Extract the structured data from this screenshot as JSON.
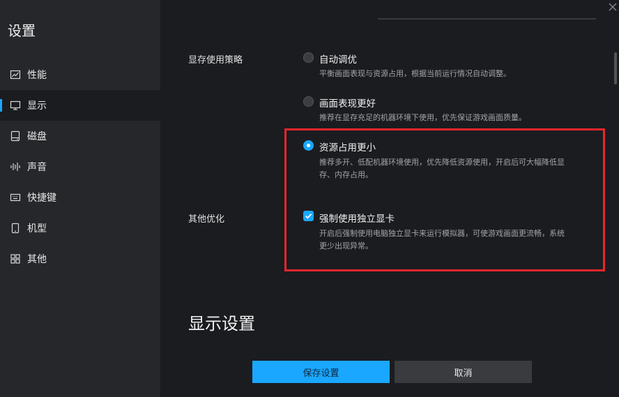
{
  "sidebar": {
    "title": "设置",
    "items": [
      {
        "label": "性能",
        "icon": "line-chart-icon"
      },
      {
        "label": "显示",
        "icon": "monitor-icon"
      },
      {
        "label": "磁盘",
        "icon": "disk-icon"
      },
      {
        "label": "声音",
        "icon": "sound-wave-icon"
      },
      {
        "label": "快捷键",
        "icon": "keyboard-icon"
      },
      {
        "label": "机型",
        "icon": "phone-icon"
      },
      {
        "label": "其他",
        "icon": "grid-icon"
      }
    ],
    "active_item": "显示"
  },
  "memory_strategy": {
    "label": "显存使用策略",
    "options": [
      {
        "title": "自动调优",
        "desc": "平衡画面表现与资源占用，根据当前运行情况自动调整。",
        "selected": false
      },
      {
        "title": "画面表现更好",
        "desc": "推荐在显存充足的机器环境下使用，优先保证游戏画面质量。",
        "selected": false
      },
      {
        "title": "资源占用更小",
        "desc_line1": "推荐多开、低配机器环境使用，优先降低资源使用，开启后可大幅降低显",
        "desc_line2": "存、内存占用。",
        "selected": true
      }
    ]
  },
  "other_optimization": {
    "label": "其他优化",
    "checkbox": {
      "title": "强制使用独立显卡",
      "desc_line1": "开启后强制使用电脑独立显卡来运行模拟器，可使游戏画面更流畅，系统",
      "desc_line2": "更少出现异常。",
      "checked": true
    }
  },
  "display_settings_heading": "显示设置",
  "buttons": {
    "save": "保存设置",
    "cancel": "取消"
  },
  "colors": {
    "accent": "#1aa7ff",
    "highlight_border": "#e8262c",
    "sidebar_bg": "#26272b",
    "content_bg": "#1b1c20"
  }
}
